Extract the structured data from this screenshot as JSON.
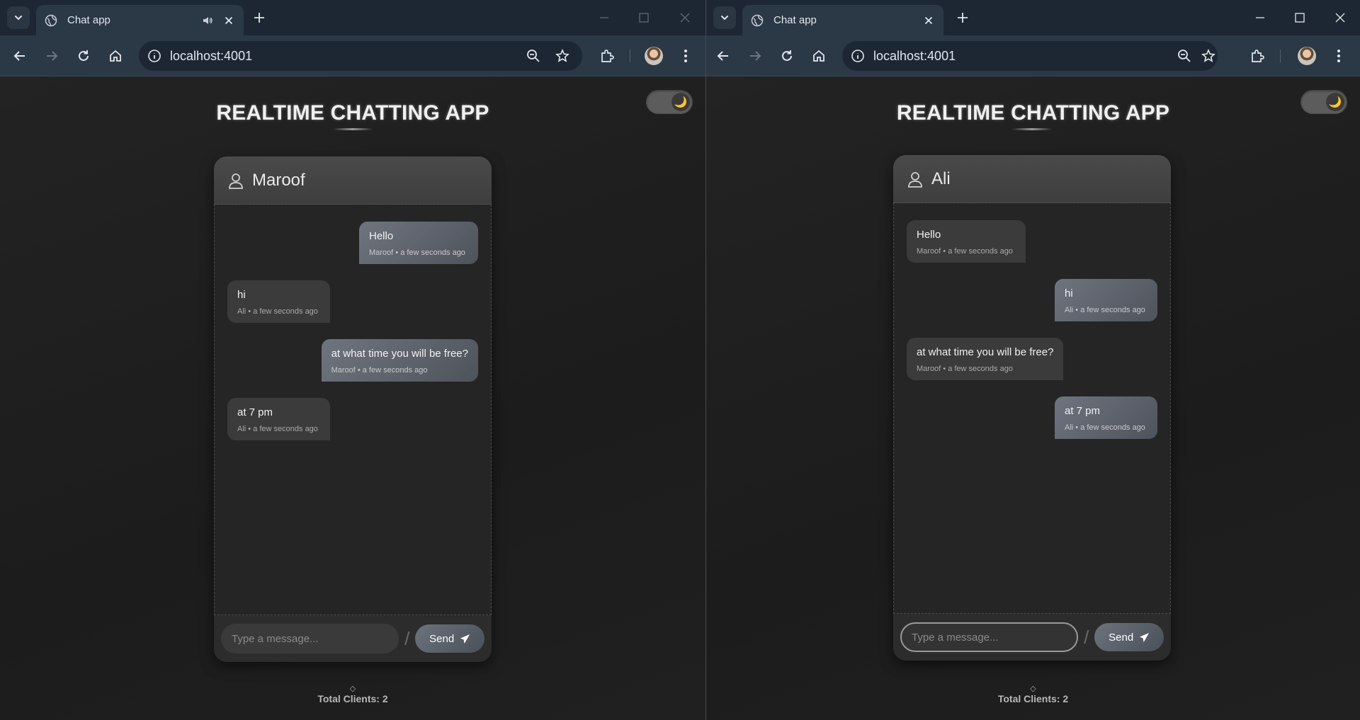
{
  "windows": [
    {
      "tab_title": "Chat app",
      "url": "localhost:4001",
      "page": {
        "title": "REALTIME CHATTING APP",
        "theme_icon": "moon-icon",
        "chat": {
          "user": "Maroof",
          "messages": [
            {
              "text": "Hello",
              "meta": "Maroof • a few seconds ago",
              "dir": "out"
            },
            {
              "text": "hi",
              "meta": "Ali • a few seconds ago",
              "dir": "in"
            },
            {
              "text": "at what time you will be free?",
              "meta": "Maroof • a few seconds ago",
              "dir": "out"
            },
            {
              "text": "at 7 pm",
              "meta": "Ali • a few seconds ago",
              "dir": "in"
            }
          ],
          "input_placeholder": "Type a message...",
          "send_label": "Send"
        },
        "clients": "Total Clients: 2"
      }
    },
    {
      "tab_title": "Chat app",
      "url": "localhost:4001",
      "page": {
        "title": "REALTIME CHATTING APP",
        "theme_icon": "moon-icon",
        "chat": {
          "user": "Ali",
          "messages": [
            {
              "text": "Hello",
              "meta": "Maroof • a few seconds ago",
              "dir": "in"
            },
            {
              "text": "hi",
              "meta": "Ali • a few seconds ago",
              "dir": "out"
            },
            {
              "text": "at what time you will be free?",
              "meta": "Maroof • a few seconds ago",
              "dir": "in"
            },
            {
              "text": "at 7 pm",
              "meta": "Ali • a few seconds ago",
              "dir": "out"
            }
          ],
          "input_placeholder": "Type a message...",
          "send_label": "Send"
        },
        "clients": "Total Clients: 2"
      }
    }
  ],
  "colors": {
    "tabbar": "#1d2733",
    "toolbar": "#2b3846",
    "page_bg": "#1e1e1e",
    "bubble_out": "#6f7580",
    "bubble_in": "#3b3b3b"
  }
}
